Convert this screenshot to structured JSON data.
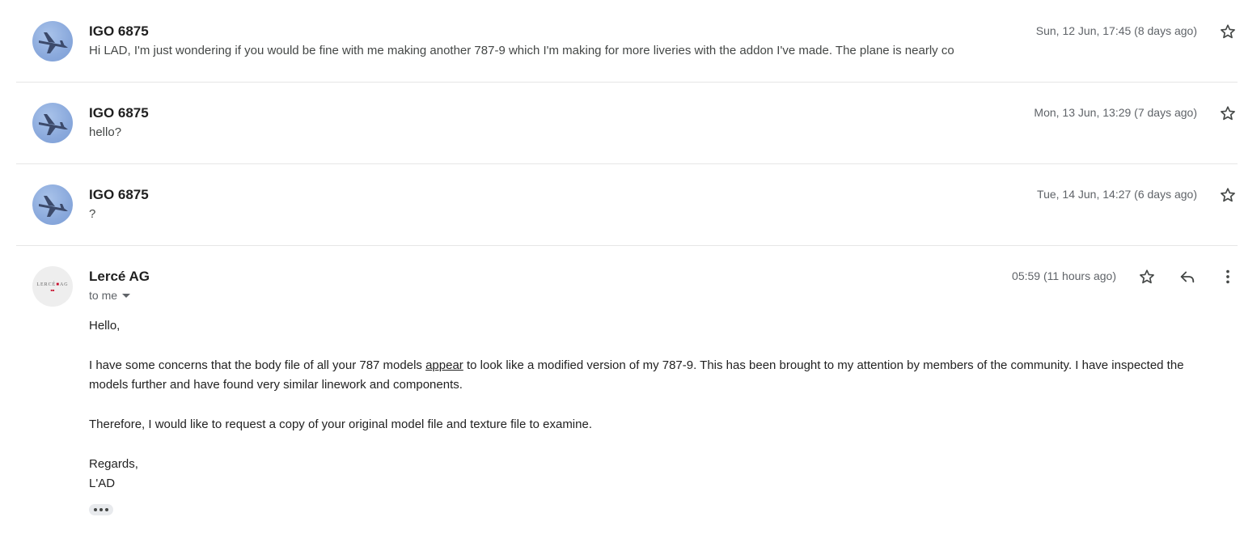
{
  "messages": [
    {
      "sender": "IGO 6875",
      "snippet": "Hi LAD, I'm just wondering if you would be fine with me making another 787-9 which I'm making for more liveries with the addon I've made. The plane is nearly co",
      "date": "Sun, 12 Jun, 17:45 (8 days ago)",
      "avatar_icon": "airplane-avatar"
    },
    {
      "sender": "IGO 6875",
      "snippet": "hello?",
      "date": "Mon, 13 Jun, 13:29 (7 days ago)",
      "avatar_icon": "airplane-avatar"
    },
    {
      "sender": "IGO 6875",
      "snippet": "?",
      "date": "Tue, 14 Jun, 14:27 (6 days ago)",
      "avatar_icon": "airplane-avatar"
    }
  ],
  "open_message": {
    "sender": "Lercé AG",
    "recipient_label": "to me",
    "date": "05:59 (11 hours ago)",
    "avatar_logo_text": "LERCÉ AG",
    "body": {
      "greeting": "Hello,",
      "para1_before": "I have some concerns that the body file of all your 787 models ",
      "para1_link": "appear",
      "para1_after": " to look like a modified version of my 787-9. This has been brought to my attention by members of the community. I have inspected the models further and have found very similar linework and components.",
      "para2": "Therefore, I would like to request a copy of your original model file and texture file to examine.",
      "closing": "Regards,",
      "signature": "L'AD"
    }
  },
  "icons": {
    "star": "star-outline-icon",
    "reply": "reply-icon",
    "more": "more-vert-icon",
    "expand": "trimmed-content-icon"
  },
  "colors": {
    "avatar_sky": "#8aa9dc",
    "divider": "#e6e6e6",
    "muted_text": "#5f6368"
  }
}
